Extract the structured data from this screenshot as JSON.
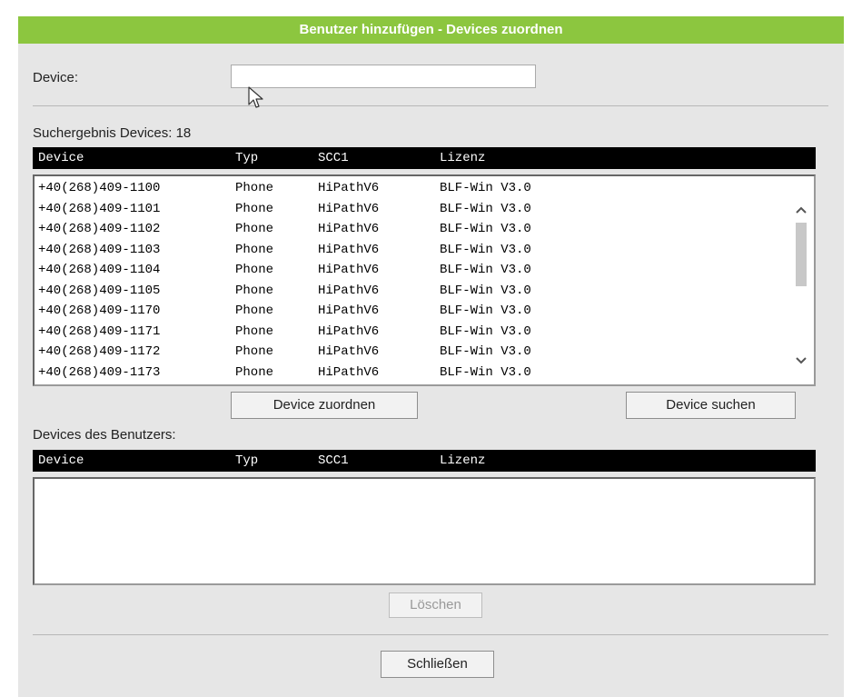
{
  "dialog": {
    "title": "Benutzer hinzufügen - Devices zuordnen",
    "device_label": "Device:",
    "device_value": "",
    "search_result_label": "Suchergebnis Devices: 18",
    "columns": [
      "Device",
      "Typ",
      "SCC1",
      "Lizenz"
    ],
    "search_results": [
      {
        "device": "+40(268)409-1100",
        "typ": "Phone",
        "scc1": "HiPathV6",
        "lizenz": "BLF-Win V3.0"
      },
      {
        "device": "+40(268)409-1101",
        "typ": "Phone",
        "scc1": "HiPathV6",
        "lizenz": "BLF-Win V3.0"
      },
      {
        "device": "+40(268)409-1102",
        "typ": "Phone",
        "scc1": "HiPathV6",
        "lizenz": "BLF-Win V3.0"
      },
      {
        "device": "+40(268)409-1103",
        "typ": "Phone",
        "scc1": "HiPathV6",
        "lizenz": "BLF-Win V3.0"
      },
      {
        "device": "+40(268)409-1104",
        "typ": "Phone",
        "scc1": "HiPathV6",
        "lizenz": "BLF-Win V3.0"
      },
      {
        "device": "+40(268)409-1105",
        "typ": "Phone",
        "scc1": "HiPathV6",
        "lizenz": "BLF-Win V3.0"
      },
      {
        "device": "+40(268)409-1170",
        "typ": "Phone",
        "scc1": "HiPathV6",
        "lizenz": "BLF-Win V3.0"
      },
      {
        "device": "+40(268)409-1171",
        "typ": "Phone",
        "scc1": "HiPathV6",
        "lizenz": "BLF-Win V3.0"
      },
      {
        "device": "+40(268)409-1172",
        "typ": "Phone",
        "scc1": "HiPathV6",
        "lizenz": "BLF-Win V3.0"
      },
      {
        "device": "+40(268)409-1173",
        "typ": "Phone",
        "scc1": "HiPathV6",
        "lizenz": "BLF-Win V3.0"
      }
    ],
    "assign_button": "Device zuordnen",
    "search_button": "Device suchen",
    "user_devices_label": "Devices des Benutzers:",
    "user_devices": [],
    "delete_button": "Löschen",
    "close_button": "Schließen"
  },
  "icons": {
    "scroll_up": "chevron-up-icon",
    "scroll_down": "chevron-down-icon",
    "cursor": "mouse-pointer-icon"
  },
  "colors": {
    "title_bar": "#8cc63f",
    "dialog_bg": "#e6e6e6",
    "table_header": "#000000"
  }
}
